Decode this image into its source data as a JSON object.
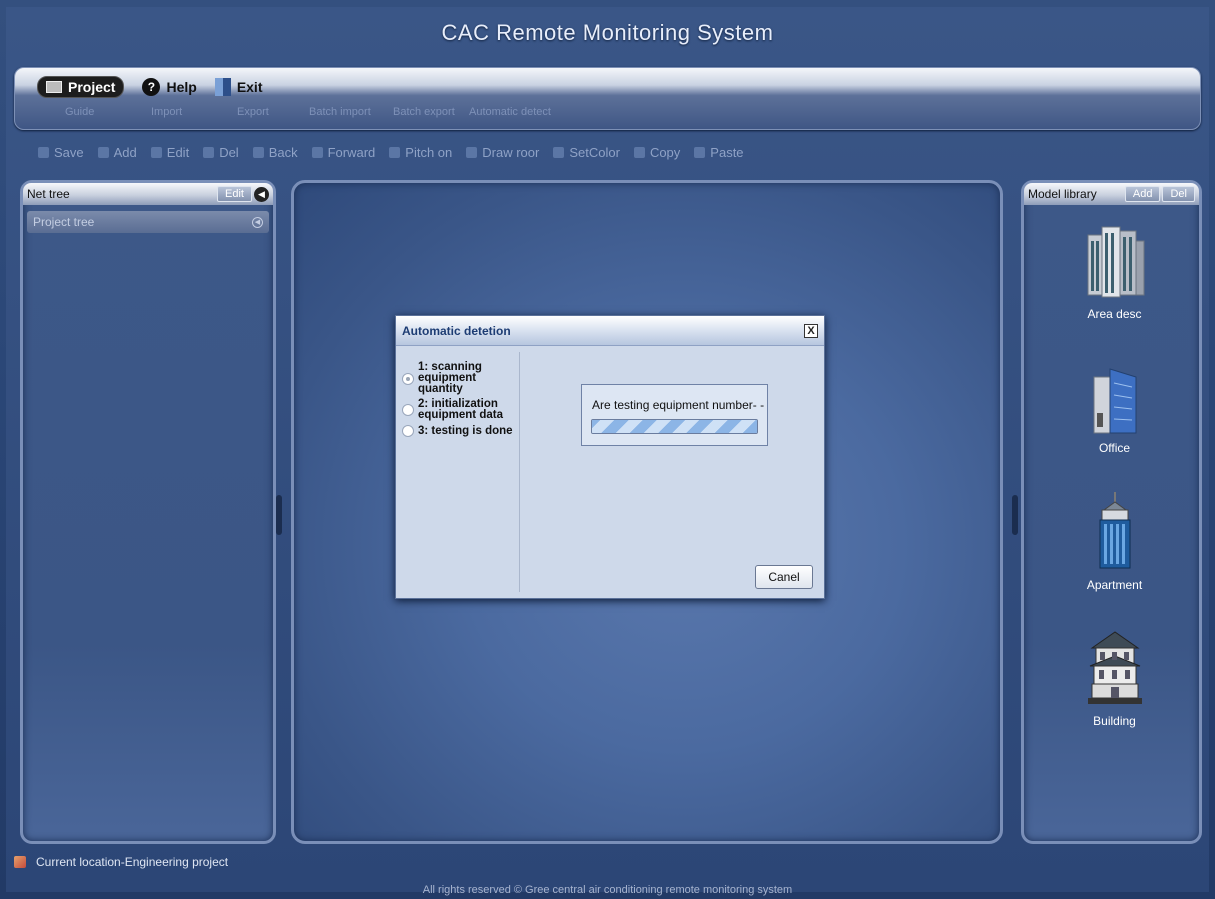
{
  "app": {
    "title": "CAC Remote Monitoring System"
  },
  "menu": {
    "items": [
      {
        "label": "Project",
        "icon": "folder-icon"
      },
      {
        "label": "Help",
        "icon": "help-icon"
      },
      {
        "label": "Exit",
        "icon": "exit-icon"
      }
    ],
    "submenu": [
      "Guide",
      "Import",
      "Export",
      "Batch import",
      "Batch export",
      "Automatic detect"
    ]
  },
  "toolbar": {
    "items": [
      {
        "label": "Save",
        "icon": "save-icon"
      },
      {
        "label": "Add",
        "icon": "add-icon"
      },
      {
        "label": "Edit",
        "icon": "edit-icon"
      },
      {
        "label": "Del",
        "icon": "delete-icon"
      },
      {
        "label": "Back",
        "icon": "back-icon"
      },
      {
        "label": "Forward",
        "icon": "forward-icon"
      },
      {
        "label": "Pitch on",
        "icon": "pointer-icon"
      },
      {
        "label": "Draw roor",
        "icon": "draw-icon"
      },
      {
        "label": "SetColor",
        "icon": "palette-icon"
      },
      {
        "label": "Copy",
        "icon": "copy-icon"
      },
      {
        "label": "Paste",
        "icon": "paste-icon"
      }
    ]
  },
  "left_panel": {
    "title": "Net tree",
    "edit_label": "Edit",
    "sub_title": "Project tree"
  },
  "right_panel": {
    "title": "Model library",
    "add_label": "Add",
    "del_label": "Del",
    "models": [
      {
        "label": "Area desc",
        "icon": "area-building-icon"
      },
      {
        "label": "Office",
        "icon": "office-building-icon"
      },
      {
        "label": "Apartment",
        "icon": "apartment-building-icon"
      },
      {
        "label": "Building",
        "icon": "building-icon"
      }
    ]
  },
  "dialog": {
    "title": "Automatic detetion",
    "close_label": "X",
    "steps": [
      {
        "text": "1: scanning equipment quantity",
        "checked": true
      },
      {
        "text": "2: initialization equipment data",
        "checked": false
      },
      {
        "text": "3: testing is done",
        "checked": false
      }
    ],
    "progress_text": "Are testing equipment number- -",
    "progress_fraction": 1.0,
    "cancel_label": "Canel"
  },
  "status": {
    "location": "Current location-Engineering project"
  },
  "footer": {
    "text": "All rights reserved © Gree central air conditioning remote monitoring system"
  },
  "colors": {
    "background": "#2a4472",
    "panel": "#3d5888",
    "dialog": "#ced9ea",
    "accent": "#1d3c73"
  }
}
